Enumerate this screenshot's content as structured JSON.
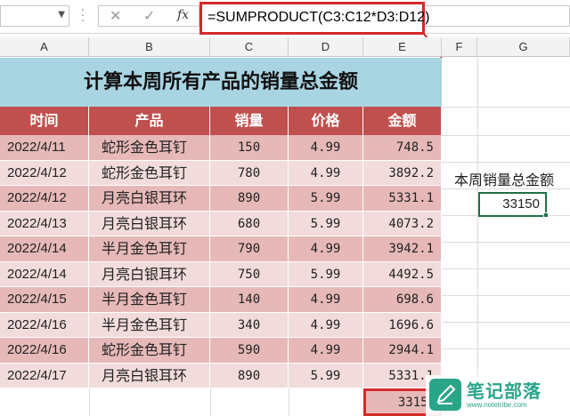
{
  "formula_bar": {
    "cancel_icon": "close-icon",
    "confirm_icon": "check-icon",
    "fx_label": "fx",
    "formula": "=SUMPRODUCT(C3:C12*D3:D12)"
  },
  "columns": [
    "A",
    "B",
    "C",
    "D",
    "E",
    "F",
    "G"
  ],
  "title": "计算本周所有产品的销量总金额",
  "headers": [
    "时间",
    "产品",
    "销量",
    "价格",
    "金额"
  ],
  "rows": [
    {
      "date": "2022/4/11",
      "product": "蛇形金色耳钉",
      "qty": "150",
      "price": "4.99",
      "amount": "748.5"
    },
    {
      "date": "2022/4/12",
      "product": "蛇形金色耳钉",
      "qty": "780",
      "price": "4.99",
      "amount": "3892.2"
    },
    {
      "date": "2022/4/12",
      "product": "月亮白银耳环",
      "qty": "890",
      "price": "5.99",
      "amount": "5331.1"
    },
    {
      "date": "2022/4/13",
      "product": "月亮白银耳环",
      "qty": "680",
      "price": "5.99",
      "amount": "4073.2"
    },
    {
      "date": "2022/4/14",
      "product": "半月金色耳钉",
      "qty": "790",
      "price": "4.99",
      "amount": "3942.1"
    },
    {
      "date": "2022/4/14",
      "product": "月亮白银耳环",
      "qty": "750",
      "price": "5.99",
      "amount": "4492.5"
    },
    {
      "date": "2022/4/15",
      "product": "半月金色耳钉",
      "qty": "140",
      "price": "4.99",
      "amount": "698.6"
    },
    {
      "date": "2022/4/16",
      "product": "半月金色耳钉",
      "qty": "340",
      "price": "4.99",
      "amount": "1696.6"
    },
    {
      "date": "2022/4/16",
      "product": "蛇形金色耳钉",
      "qty": "590",
      "price": "4.99",
      "amount": "2944.1"
    },
    {
      "date": "2022/4/17",
      "product": "月亮白银耳环",
      "qty": "890",
      "price": "5.99",
      "amount": "5331.1"
    }
  ],
  "total": "33150",
  "side": {
    "label": "本周销量总金额",
    "result": "33150"
  },
  "watermark": {
    "text": "笔记部落",
    "url": "www.notetribe.com"
  },
  "colors": {
    "header_red": "#c0504d",
    "row_dark": "#e6b9b8",
    "row_light": "#f2dcdb",
    "title_blue": "#a9d5e3",
    "highlight_red": "#d42a2a",
    "selection_green": "#1e7145"
  }
}
